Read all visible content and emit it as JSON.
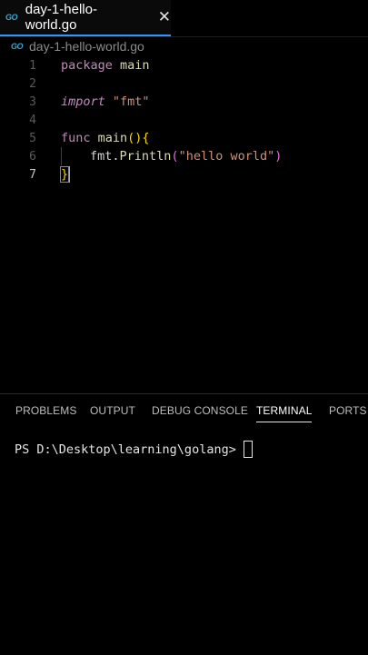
{
  "tab": {
    "icon": "go-icon",
    "icon_text": "GO",
    "label": "day-1-hello-world.go",
    "close": "✕"
  },
  "breadcrumb": {
    "icon": "go-icon",
    "icon_text": "GO",
    "label": "day-1-hello-world.go"
  },
  "editor": {
    "line_numbers": [
      "1",
      "2",
      "3",
      "4",
      "5",
      "6",
      "7"
    ],
    "lines": {
      "l1_kw": "package",
      "l1_name": " main",
      "l3_kw": "import",
      "l3_str": " \"fmt\"",
      "l5_kw": "func",
      "l5_fn": " main",
      "l5_parens": "()",
      "l5_brace": "{",
      "l6_pkg": "fmt.",
      "l6_fn": "Println",
      "l6_open": "(",
      "l6_str": "\"hello world\"",
      "l6_close": ")",
      "l7_brace": "}"
    }
  },
  "panel": {
    "tabs": [
      "PROBLEMS",
      "OUTPUT",
      "DEBUG CONSOLE",
      "TERMINAL",
      "PORTS"
    ],
    "active_tab": "TERMINAL"
  },
  "terminal": {
    "prompt": "PS D:\\Desktop\\learning\\golang>"
  },
  "colors": {
    "background": "#000000",
    "keyword": "#c586c0",
    "function": "#dcdcaa",
    "string": "#ce9178",
    "bracket": "#ffd700",
    "tab_accent": "#3794ff"
  }
}
